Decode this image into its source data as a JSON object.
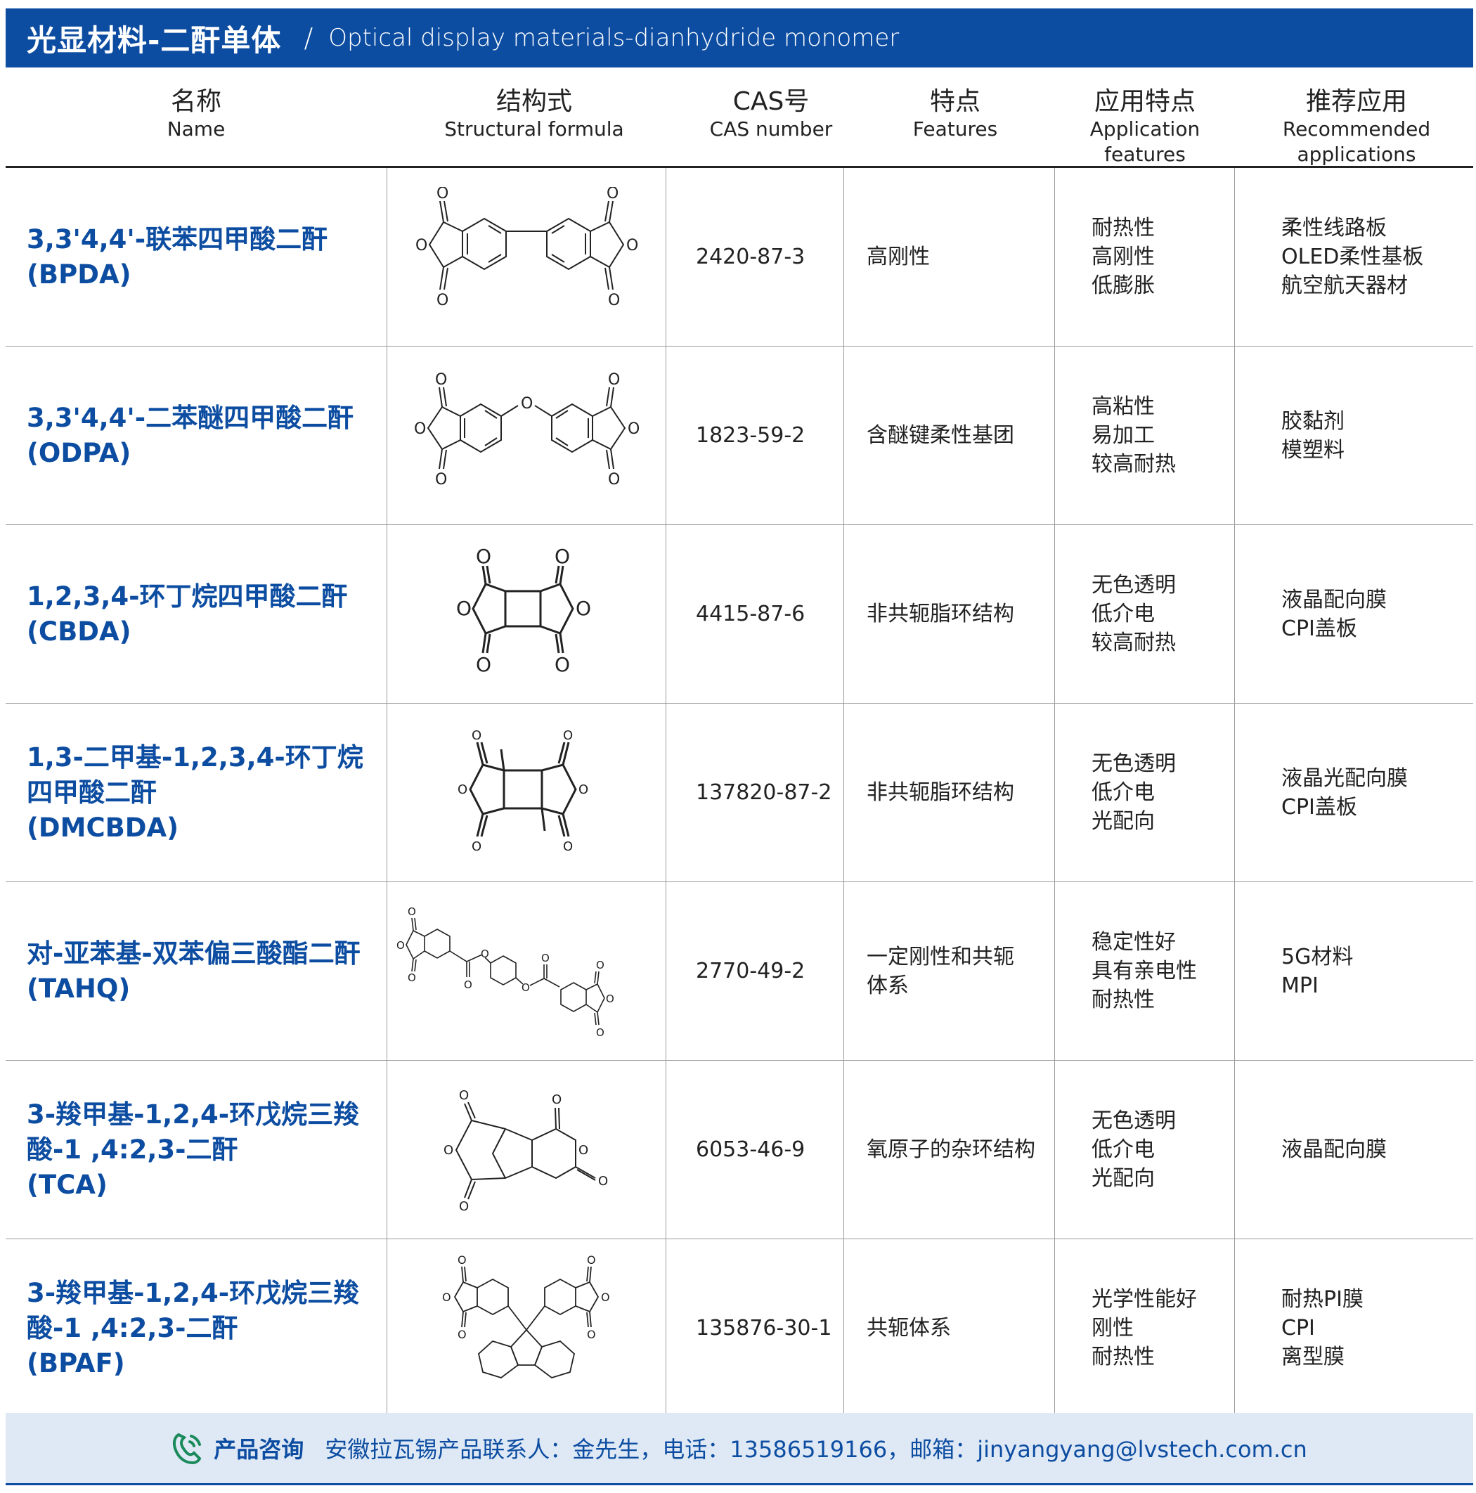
{
  "banner": {
    "title_zh": "光显材料-二酐单体",
    "separator": "/",
    "title_en": "Optical display materials-dianhydride monomer"
  },
  "columns": [
    {
      "zh": "名称",
      "en": "Name"
    },
    {
      "zh": "结构式",
      "en": "Structural formula"
    },
    {
      "zh": "CAS号",
      "en": "CAS number"
    },
    {
      "zh": "特点",
      "en": "Features"
    },
    {
      "zh": "应用特点",
      "en": "Application features"
    },
    {
      "zh": "推荐应用",
      "en": "Recommended applications"
    }
  ],
  "rows": [
    {
      "name_lines": [
        "3,3'4,4'-联苯四甲酸二酐"
      ],
      "abbr": "(BPDA)",
      "cas": "2420-87-3",
      "features": [
        "高刚性"
      ],
      "app": [
        "耐热性",
        "高刚性",
        "低膨胀"
      ],
      "rec": [
        "柔性线路板",
        "OLED柔性基板",
        "航空航天器材"
      ]
    },
    {
      "name_lines": [
        "3,3'4,4'-二苯醚四甲酸二酐"
      ],
      "abbr": "(ODPA)",
      "cas": "1823-59-2",
      "features": [
        "含醚键柔性基团"
      ],
      "app": [
        "高粘性",
        "易加工",
        "较高耐热"
      ],
      "rec": [
        "胶黏剂",
        "模塑料"
      ]
    },
    {
      "name_lines": [
        "1,2,3,4-环丁烷四甲酸二酐"
      ],
      "abbr": "(CBDA)",
      "cas": "4415-87-6",
      "features": [
        "非共轭脂环结构"
      ],
      "app": [
        "无色透明",
        "低介电",
        "较高耐热"
      ],
      "rec": [
        "液晶配向膜",
        "CPI盖板"
      ]
    },
    {
      "name_lines": [
        "1,3-二甲基-1,2,3,4-环丁烷",
        "四甲酸二酐"
      ],
      "abbr": "(DMCBDA)",
      "cas": "137820-87-2",
      "features": [
        "非共轭脂环结构"
      ],
      "app": [
        "无色透明",
        "低介电",
        "光配向"
      ],
      "rec": [
        "液晶光配向膜",
        "CPI盖板"
      ]
    },
    {
      "name_lines": [
        "对-亚苯基-双苯偏三酸酯二酐"
      ],
      "abbr": "(TAHQ)",
      "cas": "2770-49-2",
      "features": [
        "一定刚性和共轭",
        "体系"
      ],
      "app": [
        "稳定性好",
        "具有亲电性",
        "耐热性"
      ],
      "rec": [
        "5G材料",
        "MPI"
      ]
    },
    {
      "name_lines": [
        "3-羧甲基-1,2,4-环戊烷三羧",
        "酸-1 ,4:2,3-二酐"
      ],
      "abbr": "(TCA)",
      "cas": "6053-46-9",
      "features": [
        "氧原子的杂环结构"
      ],
      "app": [
        "无色透明",
        "低介电",
        "光配向"
      ],
      "rec": [
        "液晶配向膜"
      ]
    },
    {
      "name_lines": [
        "3-羧甲基-1,2,4-环戊烷三羧",
        "酸-1 ,4:2,3-二酐"
      ],
      "abbr": "(BPAF)",
      "cas": "135876-30-1",
      "features": [
        "共轭体系"
      ],
      "app": [
        "光学性能好",
        "刚性",
        "耐热性"
      ],
      "rec": [
        "耐热PI膜",
        "CPI",
        "离型膜"
      ]
    }
  ],
  "footer": {
    "icon": "phone-icon",
    "label": "产品咨询",
    "text": "安徽拉瓦锡产品联系人：金先生，电话：13586519166，邮箱：jinyangyang@lvstech.com.cn"
  },
  "colors": {
    "brand": "#0d4da1",
    "footer_bg": "#dfe9f6",
    "grid": "#9a9a9a"
  }
}
